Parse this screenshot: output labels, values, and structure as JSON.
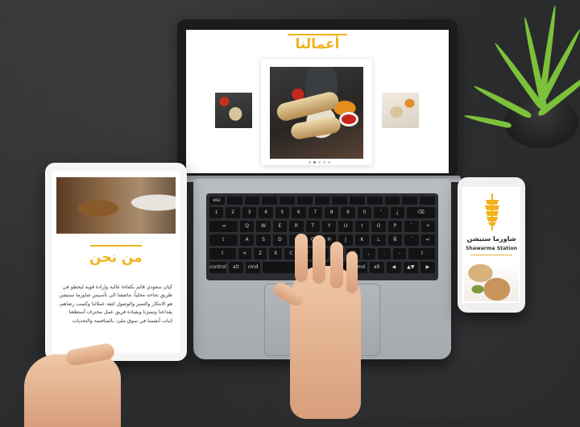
{
  "laptop": {
    "section_title": "أعمالنا",
    "carousel_dots": 5,
    "active_dot": 1,
    "keyboard_rows": [
      [
        "esc",
        "",
        "",
        "",
        "",
        "",
        "",
        "",
        "",
        "",
        "",
        "",
        ""
      ],
      [
        "1",
        "2",
        "3",
        "4",
        "5",
        "6",
        "7",
        "8",
        "9",
        "0",
        "'",
        "¿",
        "⌫"
      ],
      [
        "⇥",
        "Q",
        "W",
        "E",
        "R",
        "T",
        "Y",
        "U",
        "I",
        "O",
        "P",
        "`",
        "+"
      ],
      [
        "⇪",
        "A",
        "S",
        "D",
        "F",
        "G",
        "H",
        "J",
        "K",
        "L",
        "Ñ",
        "´",
        "↵"
      ],
      [
        "⇧",
        "<",
        "Z",
        "X",
        "C",
        "V",
        "B",
        "N",
        "M",
        ",",
        ".",
        "-",
        "⇧"
      ],
      [
        "control",
        "alt",
        "cmd",
        "",
        "cmd",
        "alt",
        "◀",
        "▲▼",
        "▶"
      ]
    ]
  },
  "tablet": {
    "heading": "من نحن",
    "body": "كيان سعودي قائم بكفاءة عالية وإرادة قوية ليخطو في طريق نجاحه محلياً، ماضفنا الى تأسيس شاورما ستيشن هو الابتكار والتميز والوصول لثقة عملائنا وكسب رضاهم، يقداعنا وتميزنا وبقيادة فريق عمل محترف أستطعنا إثبات أنفسنا في سوق ملئ، بالمنافسة والتحديات"
  },
  "phone": {
    "brand_ar": "شاورما ستيشن",
    "brand_en": "Shawarma Station",
    "accent": "#f2b21c"
  },
  "colors": {
    "accent": "#f2b21c",
    "desk": "#2b2c2e",
    "plant": "#7cc13a"
  }
}
